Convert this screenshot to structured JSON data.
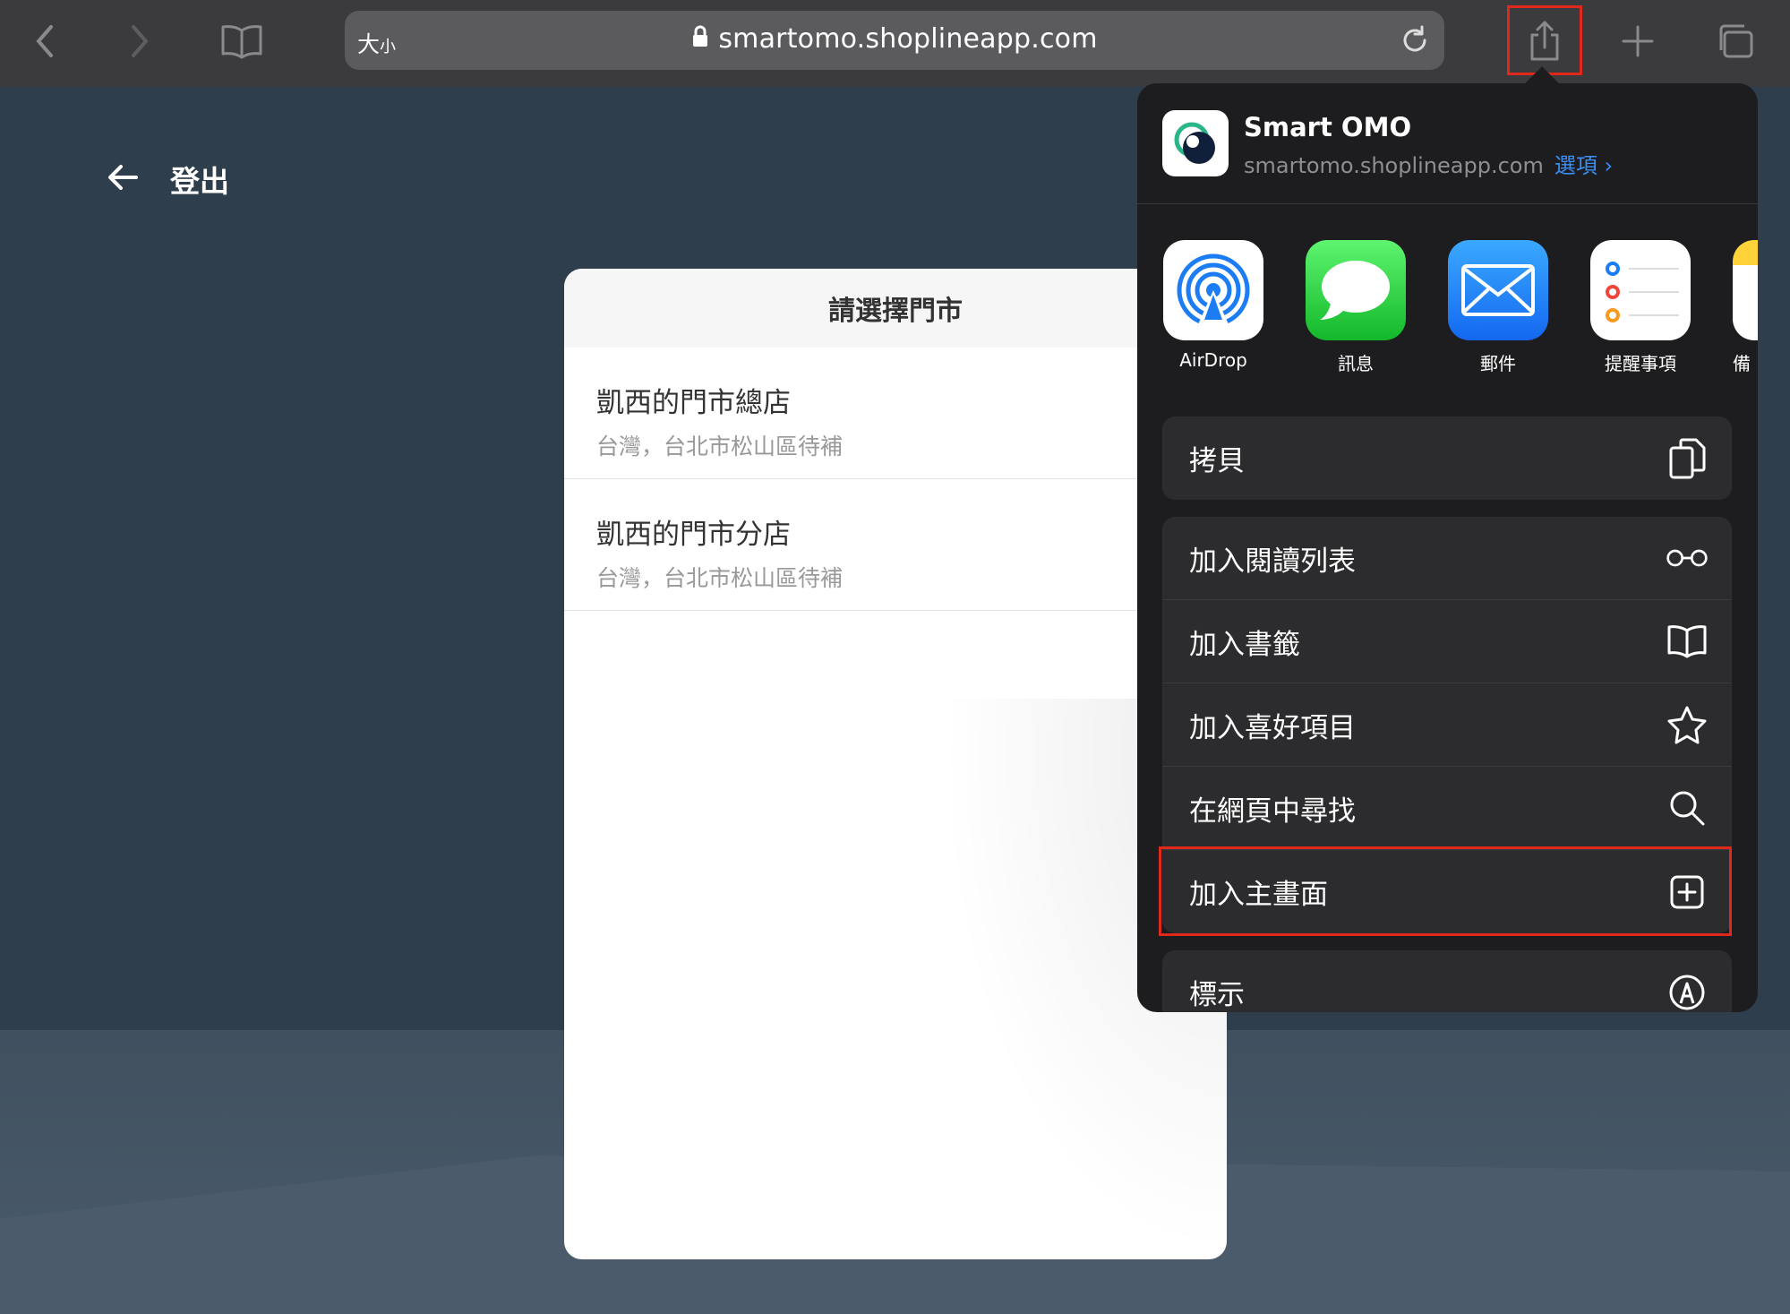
{
  "browser": {
    "text_size_label": "大",
    "text_size_small": "小",
    "url": "smartomo.shoplineapp.com",
    "icons": [
      "back-chevron-icon",
      "forward-chevron-icon",
      "bookmarks-icon",
      "lock-icon",
      "reload-icon",
      "share-icon",
      "new-tab-icon",
      "tabs-icon"
    ]
  },
  "page": {
    "back_label": "登出",
    "card_title": "請選擇門市",
    "stores": [
      {
        "name": "凱西的門市總店",
        "address": "台灣，台北市松山區待補"
      },
      {
        "name": "凱西的門市分店",
        "address": "台灣，台北市松山區待補"
      }
    ]
  },
  "share_sheet": {
    "app_name": "Smart OMO",
    "domain": "smartomo.shoplineapp.com",
    "options_label": "選項 ›",
    "apps": [
      {
        "label": "AirDrop",
        "icon": "airdrop-icon"
      },
      {
        "label": "訊息",
        "icon": "messages-icon"
      },
      {
        "label": "郵件",
        "icon": "mail-icon"
      },
      {
        "label": "提醒事項",
        "icon": "reminders-icon"
      },
      {
        "label": "備",
        "icon": "notes-icon"
      }
    ],
    "actions_group1": [
      {
        "label": "拷貝",
        "icon": "copy-icon"
      }
    ],
    "actions_group2": [
      {
        "label": "加入閱讀列表",
        "icon": "glasses-icon"
      },
      {
        "label": "加入書籤",
        "icon": "book-icon"
      },
      {
        "label": "加入喜好項目",
        "icon": "star-icon"
      },
      {
        "label": "在網頁中尋找",
        "icon": "search-icon"
      },
      {
        "label": "加入主畫面",
        "icon": "add-square-icon"
      }
    ],
    "actions_group3": [
      {
        "label": "標示",
        "icon": "markup-icon"
      }
    ]
  },
  "colors": {
    "highlight": "#e0281d",
    "link_blue": "#3b8ef5",
    "sheet_bg": "#1d1d1f",
    "row_bg": "#2c2c2e",
    "page_bg": "#2f3e4c"
  }
}
